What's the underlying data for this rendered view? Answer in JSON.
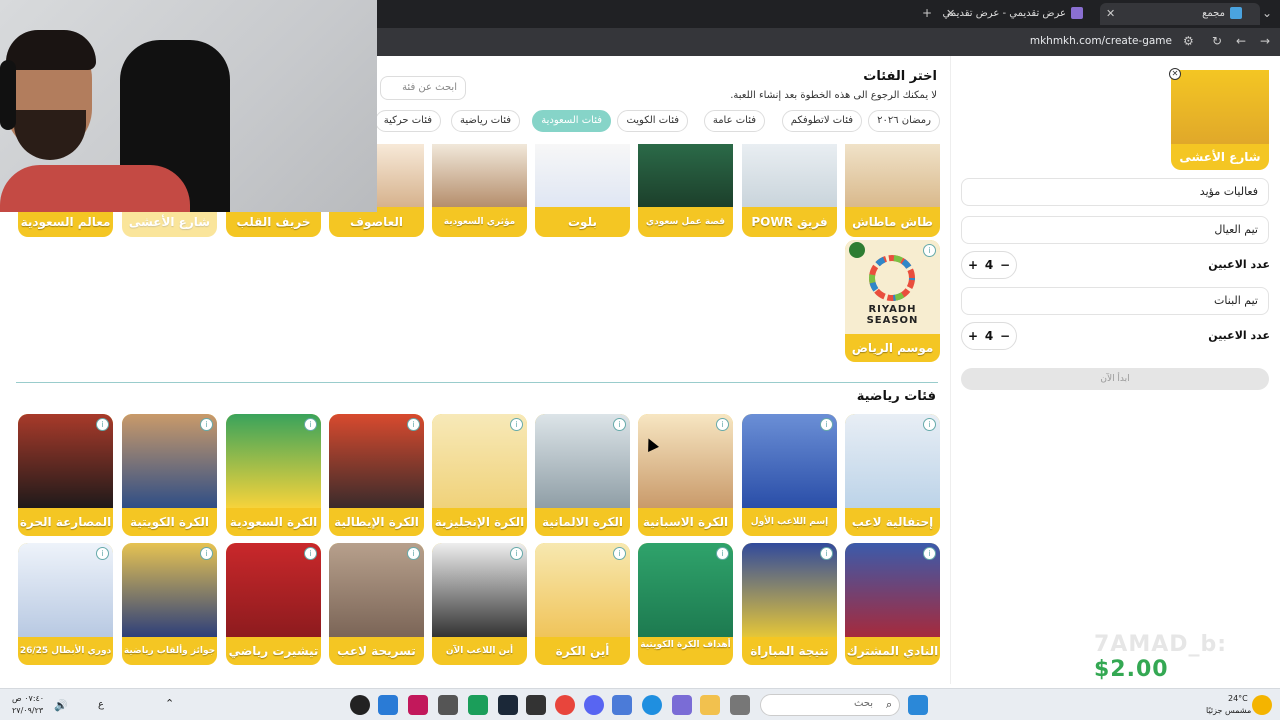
{
  "browser": {
    "tabs": [
      {
        "label": "مجمع"
      },
      {
        "label": "عرض تقديمي - عرض تقديمي"
      }
    ],
    "url": "mkhmkh.com/create-game"
  },
  "main": {
    "title": "اختر الفئات",
    "subtitle": "لا يمكنك الرجوع الى هذه الخطوة بعد إنشاء اللعبة.",
    "search_placeholder": "ابحث عن فئة",
    "chips": [
      "رمضان ٢٠٢٦",
      "فئات لاتطوفكم",
      "فئات عامة",
      "فئات الكويت",
      "فئات السعودية",
      "فئات رياضية",
      "فئات حركية"
    ],
    "active_chip": "فئات السعودية",
    "top_row": [
      "طاش ماطاش",
      "فريق POWR",
      "قصة عمل سعودي",
      "بلوت",
      "مؤثري السعودية",
      "العاصوف",
      "خريف القلب",
      "شارع الأعشى",
      "معالم السعودية"
    ],
    "riyadh_card": {
      "label": "موسم الرياض",
      "logo_text": "RIYADH SEASON"
    },
    "sports_section_title": "فئات رياضية",
    "sports_row1": [
      "إحتفالية لاعب",
      "إسم اللاعب الأول",
      "الكرة الاسبانية",
      "الكرة الالمانية",
      "الكرة الإنجليزية",
      "الكرة الإيطالية",
      "الكرة السعودية",
      "الكرة الكويتية",
      "المصارعة الحرة"
    ],
    "sports_row2": [
      "النادي المشترك",
      "نتيجة المباراة",
      "أهداف الكرة الكويتية",
      "أين الكرة",
      "أين اللاعب الآن",
      "تسريحة لاعب",
      "تيشيرت رياضي",
      "جوائز وألقاب رياضية",
      "دوري الأبطال 26/25"
    ]
  },
  "sidebar": {
    "selected_card": "شارع الأعشى",
    "game_name": "فعاليات مؤيد",
    "team1": "تيم العيال",
    "team2": "تيم البنات",
    "players_label": "عدد الاعبين",
    "team1_count": "4",
    "team2_count": "4",
    "start_button": "ابدأ الآن"
  },
  "overlay": {
    "watermark_name": "7AMAD_b:",
    "watermark_amount": "$2.00"
  },
  "taskbar": {
    "search_placeholder": "بحث",
    "time": "٠٧:٤٠ ص",
    "date": "٢٧/٠٩/٢٣",
    "weather_temp": "24°C",
    "weather_desc": "مشمس جزئيًا",
    "lang": "ع"
  },
  "colors": {
    "card_yellow": "#f4c623",
    "accent_teal": "#86d4c8"
  }
}
